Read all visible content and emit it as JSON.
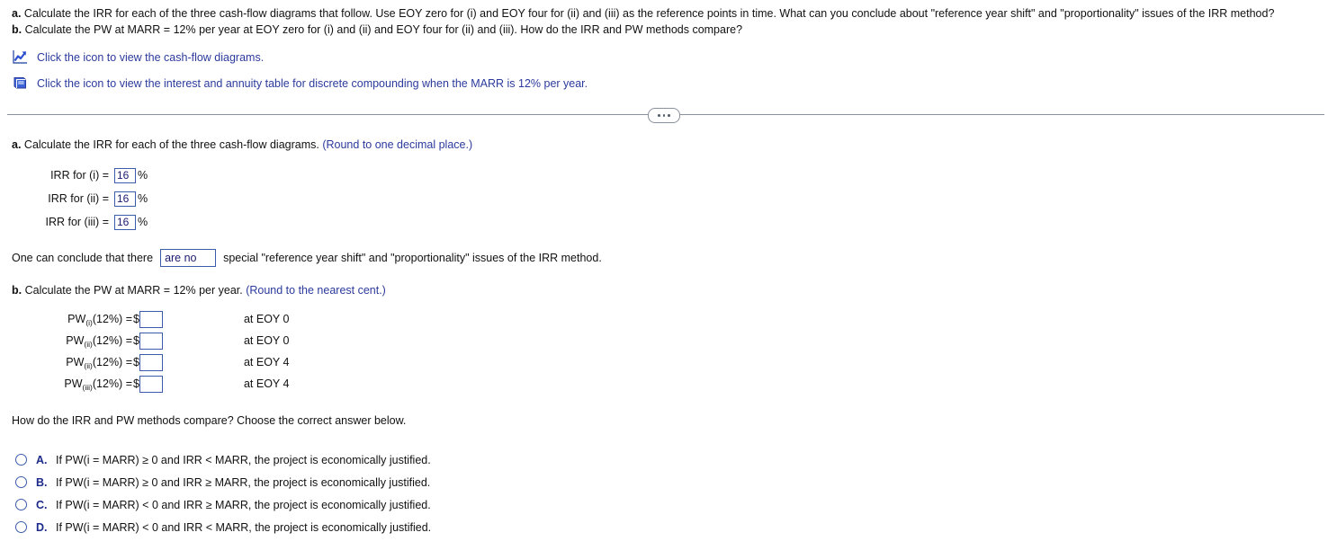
{
  "stem": {
    "a_label": "a.",
    "a_text": "Calculate the IRR for each of the three cash-flow diagrams that follow. Use EOY zero for (i) and EOY four for (ii) and (iii) as the reference points in time. What can you conclude about \"reference year shift\" and \"proportionality\" issues of the IRR method?",
    "b_label": "b.",
    "b_text": "Calculate the PW at MARR = 12% per year at EOY zero for (i) and (ii) and EOY four for (ii) and (iii). How do the IRR and PW methods compare?"
  },
  "icon_links": [
    {
      "icon": "line-chart-icon",
      "text": "Click the icon to view the cash-flow diagrams."
    },
    {
      "icon": "book-icon",
      "text": "Click the icon to view the interest and annuity table for discrete compounding when the MARR is 12% per year."
    }
  ],
  "divider": {
    "collapse_label": "..."
  },
  "part_a": {
    "label": "a.",
    "text": "Calculate the IRR for each of the three cash-flow diagrams.",
    "hint": "(Round to one decimal place.)",
    "rows": [
      {
        "label": "IRR for (i) =",
        "value": "16",
        "unit": "%"
      },
      {
        "label": "IRR for (ii) =",
        "value": "16",
        "unit": "%"
      },
      {
        "label": "IRR for (iii) =",
        "value": "16",
        "unit": "%"
      }
    ]
  },
  "conclusion": {
    "prefix": "One can conclude that there",
    "selected": "are no",
    "options": [
      "are no",
      "are"
    ],
    "suffix": "special \"reference year shift\" and \"proportionality\" issues of the IRR method."
  },
  "part_b": {
    "label": "b.",
    "text": "Calculate the PW at MARR = 12% per year.",
    "hint": "(Round to the nearest cent.)",
    "rows": [
      {
        "prefix": "PW",
        "subscript": "(i)",
        "suffix": "(12%) =",
        "currency": "$",
        "value": "",
        "eoy": "at EOY 0"
      },
      {
        "prefix": "PW",
        "subscript": "(ii)",
        "suffix": "(12%) =",
        "currency": "$",
        "value": "",
        "eoy": "at EOY 0"
      },
      {
        "prefix": "PW",
        "subscript": "(ii)",
        "suffix": "(12%) =",
        "currency": "$",
        "value": "",
        "eoy": "at EOY 4"
      },
      {
        "prefix": "PW",
        "subscript": "(iii)",
        "suffix": "(12%) =",
        "currency": "$",
        "value": "",
        "eoy": "at EOY 4"
      }
    ]
  },
  "compare": {
    "question": "How do the IRR and PW methods compare? Choose the correct answer below."
  },
  "choices": [
    {
      "letter": "A.",
      "text": "If PW(i = MARR) ≥ 0 and IRR < MARR, the project is economically justified."
    },
    {
      "letter": "B.",
      "text": "If PW(i = MARR) ≥ 0 and IRR ≥ MARR, the project is economically justified."
    },
    {
      "letter": "C.",
      "text": "If PW(i = MARR) < 0 and IRR ≥ MARR, the project is economically justified."
    },
    {
      "letter": "D.",
      "text": "If PW(i = MARR) < 0 and IRR < MARR, the project is economically justified."
    }
  ],
  "colors": {
    "link_blue": "#2b3a9c",
    "box_border": "#3b5cab",
    "answer_text": "#1b1b6f",
    "divider_gray": "#8a919b"
  }
}
